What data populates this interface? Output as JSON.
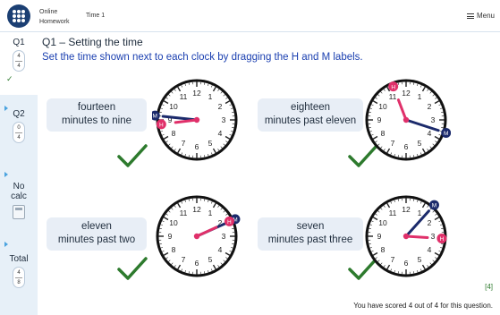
{
  "header": {
    "brand_line1": "Online",
    "brand_line2": "Homework",
    "timer": "Time 1",
    "menu": "Menu"
  },
  "sidebar": {
    "q1": {
      "label": "Q1",
      "score": "4",
      "total": "4"
    },
    "q2": {
      "label": "Q2",
      "score": "0",
      "total": "4"
    },
    "calc": {
      "line1": "No",
      "line2": "calc"
    },
    "total": {
      "label": "Total",
      "score": "4",
      "total": "8"
    }
  },
  "question": {
    "title": "Q1 – Setting the time",
    "instruction": "Set the time shown next to each clock by dragging the H and M labels."
  },
  "clocks": [
    {
      "line1": "fourteen",
      "line2": "minutes to nine",
      "hour": 8,
      "minute": 46
    },
    {
      "line1": "eighteen",
      "line2": "minutes past eleven",
      "hour": 11,
      "minute": 18
    },
    {
      "line1": "eleven",
      "line2": "minutes past two",
      "hour": 2,
      "minute": 11
    },
    {
      "line1": "seven",
      "line2": "minutes past three",
      "hour": 3,
      "minute": 7
    }
  ],
  "handle_labels": {
    "hour": "H",
    "minute": "M"
  },
  "colors": {
    "hour_hand": "#e0306a",
    "minute_hand": "#1b2a6b",
    "check": "#2d7a2d",
    "instruction": "#1a3fb0"
  },
  "result": {
    "marks": "[4]",
    "message": "You have scored 4 out of 4 for this question."
  }
}
